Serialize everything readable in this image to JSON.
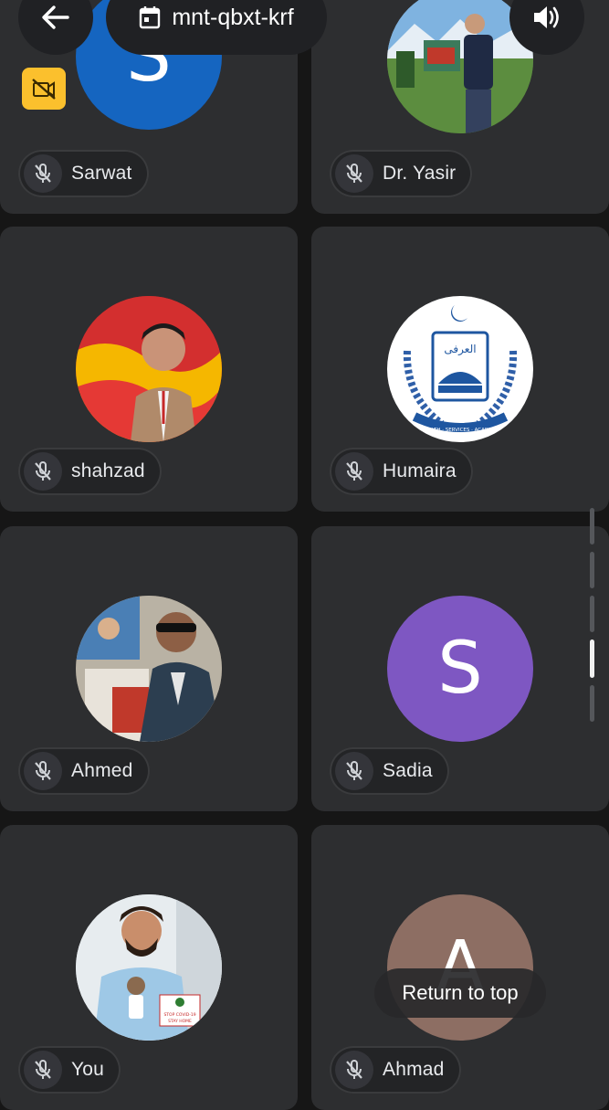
{
  "header": {
    "back_icon": "arrow-left-icon",
    "meeting_code": "mnt-qbxt-krf",
    "calendar_icon": "calendar-icon",
    "speaker_icon": "speaker-icon",
    "camera_off_icon": "camera-off-icon"
  },
  "participants": [
    {
      "name": "Sarwat",
      "avatar": "letter",
      "letter": "S",
      "color": "#1565c0",
      "muted": true
    },
    {
      "name": "Dr. Yasir",
      "avatar": "photo-outdoor",
      "muted": true
    },
    {
      "name": "shahzad",
      "avatar": "photo-portrait-red",
      "muted": true
    },
    {
      "name": "Humaira",
      "avatar": "logo-emblem",
      "muted": true
    },
    {
      "name": "Ahmed",
      "avatar": "photo-event",
      "muted": true
    },
    {
      "name": "Sadia",
      "avatar": "letter",
      "letter": "S",
      "color": "#7e57c2",
      "muted": true
    },
    {
      "name": "You",
      "avatar": "photo-self",
      "muted": true
    },
    {
      "name": "Ahmad",
      "avatar": "letter",
      "letter": "A",
      "color": "#8d6e63",
      "muted": true
    }
  ],
  "emblem_text": {
    "top": "العرفی",
    "bottom": "HEALTH · SERVICES · ACADEMY"
  },
  "poster_text": {
    "line1": "STOP COVID-19",
    "line2": "STAY HOME"
  },
  "return_to_top": "Return to top",
  "colors": {
    "tile": "#2d2e30",
    "background": "#161616",
    "camera_badge": "#fbc02d"
  }
}
